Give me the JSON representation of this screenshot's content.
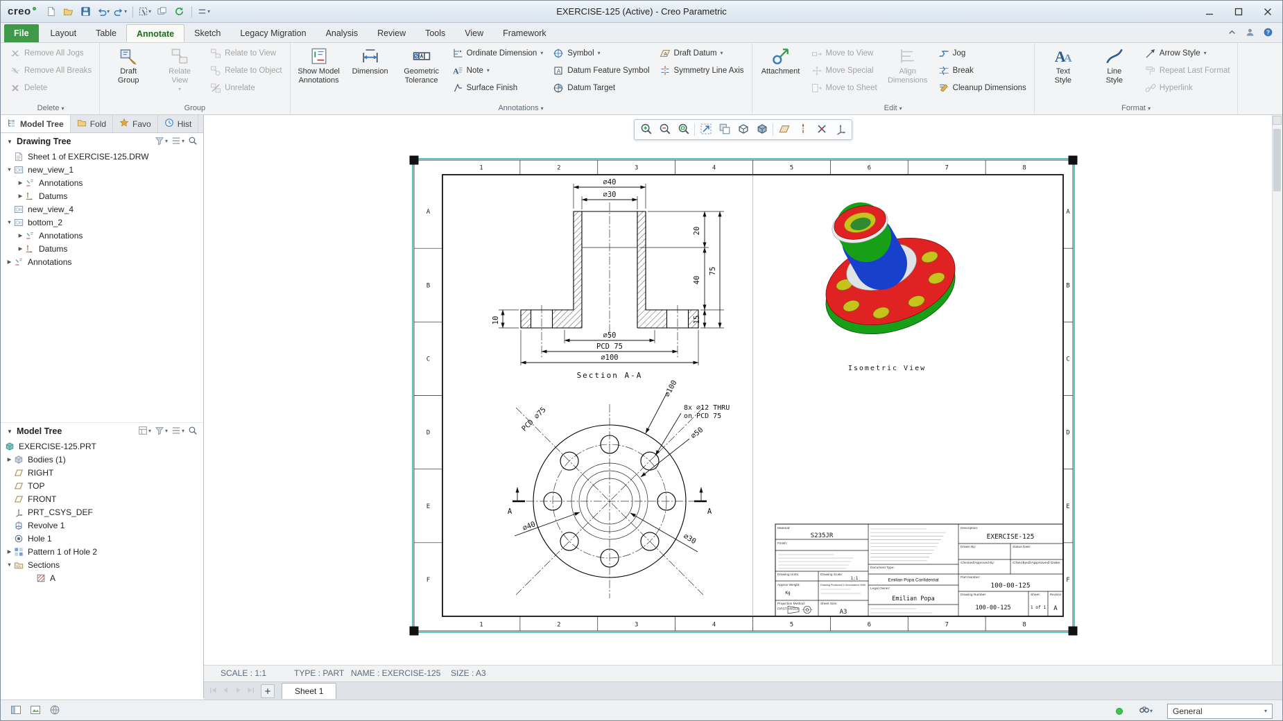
{
  "window": {
    "title": "EXERCISE-125 (Active) - Creo Parametric",
    "brand": "creo"
  },
  "colors": {
    "accent": "#3f9948",
    "status_ok": "#3ec54b",
    "selection": "#17b1b1",
    "iso_red": "#e02222",
    "iso_green": "#17a017",
    "iso_blue": "#1840cc",
    "iso_yellow": "#c6c41c"
  },
  "quick_access": [
    {
      "icon": "new-file"
    },
    {
      "icon": "open-file"
    },
    {
      "icon": "save"
    },
    {
      "icon": "undo",
      "arrow": true
    },
    {
      "icon": "redo",
      "arrow": true
    },
    {
      "sep": true
    },
    {
      "icon": "select-filter",
      "arrow": true
    },
    {
      "icon": "new-window"
    },
    {
      "icon": "regenerate"
    },
    {
      "sep": true
    },
    {
      "icon": "customize",
      "arrow": true
    }
  ],
  "menu": {
    "tabs": [
      {
        "label": "File",
        "file": true
      },
      {
        "label": "Layout"
      },
      {
        "label": "Table"
      },
      {
        "label": "Annotate",
        "active": true
      },
      {
        "label": "Sketch"
      },
      {
        "label": "Legacy Migration"
      },
      {
        "label": "Analysis"
      },
      {
        "label": "Review"
      },
      {
        "label": "Tools"
      },
      {
        "label": "View"
      },
      {
        "label": "Framework"
      }
    ],
    "right": [
      "collapse-ribbon",
      "user",
      "help"
    ]
  },
  "ribbon": {
    "groups": [
      {
        "label": "Delete",
        "dropdown": true,
        "columns": [
          {
            "type": "stack",
            "items": [
              {
                "label": "Remove All Jogs",
                "icon": "remove-jogs",
                "disabled": true
              },
              {
                "label": "Remove All Breaks",
                "icon": "remove-breaks",
                "disabled": true
              },
              {
                "label": "Delete",
                "icon": "delete",
                "disabled": true
              }
            ]
          }
        ]
      },
      {
        "label": "Group",
        "dropdown": false,
        "columns": [
          {
            "type": "large",
            "items": [
              {
                "label": "Draft Group",
                "lines": [
                  "Draft",
                  "Group"
                ],
                "icon": "draft-group"
              }
            ]
          },
          {
            "type": "large",
            "items": [
              {
                "label": "Relate View",
                "lines": [
                  "Relate",
                  "View"
                ],
                "icon": "relate-view",
                "disabled": true,
                "arrow": true
              }
            ]
          },
          {
            "type": "stack",
            "items": [
              {
                "label": "Relate to View",
                "icon": "relate-to-view",
                "disabled": true
              },
              {
                "label": "Relate to Object",
                "icon": "relate-to-object",
                "disabled": true
              },
              {
                "label": "Unrelate",
                "icon": "unrelate",
                "disabled": true
              }
            ]
          }
        ]
      },
      {
        "label": "Annotations",
        "dropdown": true,
        "columns": [
          {
            "type": "large",
            "items": [
              {
                "label": "Show Model Annotations",
                "lines": [
                  "Show Model",
                  "Annotations"
                ],
                "icon": "show-annotations"
              }
            ]
          },
          {
            "type": "large",
            "items": [
              {
                "label": "Dimension",
                "lines": [
                  "Dimension"
                ],
                "icon": "dimension"
              }
            ]
          },
          {
            "type": "large",
            "items": [
              {
                "label": "Geometric Tolerance",
                "lines": [
                  "Geometric",
                  "Tolerance"
                ],
                "icon": "gtol"
              }
            ]
          },
          {
            "type": "stack",
            "items": [
              {
                "label": "Ordinate Dimension",
                "icon": "ordinate",
                "arrow": true
              },
              {
                "label": "Note",
                "icon": "note",
                "arrow": true
              },
              {
                "label": "Surface Finish",
                "icon": "surface-finish"
              }
            ]
          },
          {
            "type": "stack",
            "items": [
              {
                "label": "Symbol",
                "icon": "symbol",
                "arrow": true
              },
              {
                "label": "Datum Feature Symbol",
                "icon": "datum-feature"
              },
              {
                "label": "Datum Target",
                "icon": "datum-target"
              }
            ]
          },
          {
            "type": "stack",
            "items": [
              {
                "label": "Draft Datum",
                "icon": "draft-datum",
                "arrow": true
              },
              {
                "label": "Symmetry Line Axis",
                "icon": "symmetry-axis"
              }
            ]
          }
        ]
      },
      {
        "label": "Edit",
        "dropdown": true,
        "columns": [
          {
            "type": "large",
            "items": [
              {
                "label": "Attachment",
                "lines": [
                  "Attachment"
                ],
                "icon": "attachment"
              }
            ]
          },
          {
            "type": "stack",
            "items": [
              {
                "label": "Move to View",
                "icon": "move-view",
                "disabled": true
              },
              {
                "label": "Move Special",
                "icon": "move-special",
                "disabled": true
              },
              {
                "label": "Move to Sheet",
                "icon": "move-sheet",
                "disabled": true
              }
            ]
          },
          {
            "type": "large",
            "items": [
              {
                "label": "Align Dimensions",
                "lines": [
                  "Align",
                  "Dimensions"
                ],
                "icon": "align-dims",
                "disabled": true
              }
            ]
          },
          {
            "type": "stack",
            "items": [
              {
                "label": "Jog",
                "icon": "jog"
              },
              {
                "label": "Break",
                "icon": "break"
              },
              {
                "label": "Cleanup Dimensions",
                "icon": "cleanup"
              }
            ]
          }
        ]
      },
      {
        "label": "Format",
        "dropdown": true,
        "columns": [
          {
            "type": "large",
            "items": [
              {
                "label": "Text Style",
                "lines": [
                  "Text",
                  "Style"
                ],
                "icon": "text-style"
              }
            ]
          },
          {
            "type": "large",
            "items": [
              {
                "label": "Line Style",
                "lines": [
                  "Line",
                  "Style"
                ],
                "icon": "line-style"
              }
            ]
          },
          {
            "type": "stack",
            "items": [
              {
                "label": "Arrow Style",
                "icon": "arrow-style",
                "arrow": true
              },
              {
                "label": "Repeat Last Format",
                "icon": "repeat-format",
                "disabled": true
              },
              {
                "label": "Hyperlink",
                "icon": "hyperlink",
                "disabled": true
              }
            ]
          }
        ]
      }
    ]
  },
  "panel": {
    "tabs": [
      {
        "label": "Model Tree",
        "icon": "model-tree",
        "active": true
      },
      {
        "label": "Fold",
        "icon": "folder"
      },
      {
        "label": "Favo",
        "icon": "favorites"
      },
      {
        "label": "Hist",
        "icon": "history"
      }
    ],
    "drawing_tree": {
      "title": "Drawing Tree",
      "toolbar": [
        "tree-filter",
        "tree-display",
        "search"
      ],
      "rows": [
        {
          "indent": 0,
          "expander": null,
          "icon": "sheet",
          "label": "Sheet 1 of EXERCISE-125.DRW"
        },
        {
          "indent": 0,
          "expander": "open",
          "icon": "view",
          "label": "new_view_1"
        },
        {
          "indent": 1,
          "expander": "closed",
          "icon": "annotations",
          "label": "Annotations"
        },
        {
          "indent": 1,
          "expander": "closed",
          "icon": "datums",
          "label": "Datums"
        },
        {
          "indent": 0,
          "expander": null,
          "icon": "view",
          "label": "new_view_4"
        },
        {
          "indent": 0,
          "expander": "open",
          "icon": "view",
          "label": "bottom_2"
        },
        {
          "indent": 1,
          "expander": "closed",
          "icon": "annotations",
          "label": "Annotations"
        },
        {
          "indent": 1,
          "expander": "closed",
          "icon": "datums",
          "label": "Datums"
        },
        {
          "indent": 0,
          "expander": "closed",
          "icon": "annotations",
          "label": "Annotations"
        }
      ]
    },
    "model_tree": {
      "title": "Model Tree",
      "toolbar": [
        "model-display",
        "tree-filter",
        "tree-display",
        "search"
      ],
      "rows": [
        {
          "indent": 0,
          "expander": null,
          "noslot": true,
          "icon": "part",
          "label": "EXERCISE-125.PRT"
        },
        {
          "indent": 0,
          "expander": "closed",
          "icon": "bodies",
          "label": "Bodies (1)"
        },
        {
          "indent": 0,
          "expander": null,
          "icon": "plane",
          "label": "RIGHT"
        },
        {
          "indent": 0,
          "expander": null,
          "icon": "plane",
          "label": "TOP"
        },
        {
          "indent": 0,
          "expander": null,
          "icon": "plane",
          "label": "FRONT"
        },
        {
          "indent": 0,
          "expander": null,
          "icon": "csys",
          "label": "PRT_CSYS_DEF"
        },
        {
          "indent": 0,
          "expander": null,
          "icon": "revolve",
          "label": "Revolve 1"
        },
        {
          "indent": 0,
          "expander": null,
          "icon": "hole",
          "label": "Hole 1"
        },
        {
          "indent": 0,
          "expander": "closed",
          "icon": "pattern",
          "label": "Pattern 1 of Hole 2"
        },
        {
          "indent": 0,
          "expander": "open",
          "icon": "sections",
          "label": "Sections"
        },
        {
          "indent": 2,
          "expander": null,
          "icon": "section",
          "label": "A"
        }
      ]
    }
  },
  "graphics_toolbar": {
    "items": [
      "zoom-in",
      "zoom-out",
      "zoom-window",
      "refit",
      "repaint",
      "display-style",
      "shaded",
      "datum-plane",
      "datum-axis",
      "datum-point",
      "datum-csys"
    ]
  },
  "status": {
    "scale": "SCALE : 1:1",
    "type": "TYPE : PART",
    "name": "NAME : EXERCISE-125",
    "size": "SIZE : A3"
  },
  "sheets": {
    "tabs": [
      {
        "label": "Sheet 1",
        "active": true
      }
    ]
  },
  "bottom": {
    "left_icons": [
      "panel-toggle",
      "display-toggle",
      "browser-toggle"
    ],
    "filter_label": "General"
  },
  "drawing": {
    "zones_top": [
      "1",
      "2",
      "3",
      "4",
      "5",
      "6",
      "7",
      "8"
    ],
    "zones_side": [
      "A",
      "B",
      "C",
      "D",
      "E",
      "F"
    ],
    "section": {
      "d40": "⌀40",
      "d30": "⌀30",
      "dim20": "20",
      "dim40": "40",
      "dim75": "75",
      "dim15": "15",
      "dim10": "10",
      "d50": "⌀50",
      "pcd75": "PCD 75",
      "d100": "⌀100",
      "label": "Section A-A"
    },
    "front": {
      "pcd": "PCD ⌀75",
      "d100": "⌀100",
      "d50": "⌀50",
      "note1": "8x ⌀12 THRU",
      "note2": "on PCD 75",
      "d40": "⌀40",
      "d30": "⌀30",
      "a": "A"
    },
    "iso": {
      "label": "Isometric View"
    },
    "titleblock": {
      "material_label": "Material:",
      "material": "S235JR",
      "finish_label": "Finish:",
      "units_label": "Drawing Units:",
      "scale_label": "Drawing Scale:",
      "scale": "1:1",
      "weight_label": "Approx Weight:",
      "weight": "Kg",
      "standard_label": "Drawing Produced In Accordance With:",
      "projection_label": "Projection Method:",
      "projection": "FIRST ANGLE",
      "size_label": "Sheet Size:",
      "size": "A3",
      "doc_type_label": "Document Type:",
      "confidential": "Emilian Popa Confidential",
      "legal_label": "Legal Owner:",
      "legal_owner": "Emilian Popa",
      "description_label": "Description:",
      "description": "EXERCISE-125",
      "drawn_label": "Drawn By:",
      "status_date_label": "Status Date:",
      "checked_label": "Checked/Approved By:",
      "checked_date_label": "Checked/Approved Date:",
      "part_label": "Part Number:",
      "part_number": "100-00-125",
      "dwg_label": "Drawing Number:",
      "drawing_number": "100-00-125",
      "sheet_label": "Sheet:",
      "sheet": "1 of 1",
      "rev_label": "Revision:",
      "revision": "A"
    }
  }
}
